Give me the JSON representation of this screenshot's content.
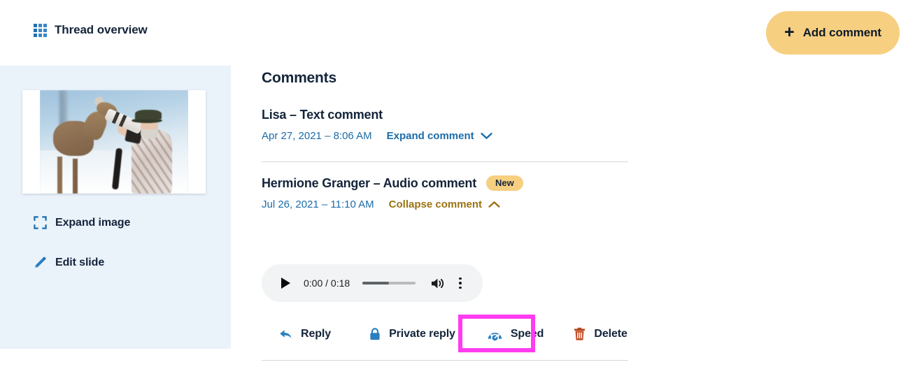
{
  "header": {
    "thread_overview_label": "Thread overview",
    "thread_overview_icon": "grid-icon",
    "add_comment_label": "Add comment",
    "add_comment_plus": "+",
    "add_comment_bg": "#f7cf80"
  },
  "sidebar": {
    "bg": "#eaf2fa",
    "thumbnail_alt": "Photographer in snow camouflage with telephoto lens being nuzzled by a deer",
    "actions": [
      {
        "label": "Expand image",
        "icon": "expand-icon"
      },
      {
        "label": "Edit slide",
        "icon": "pencil-icon"
      }
    ]
  },
  "main": {
    "title": "Comments",
    "comments": [
      {
        "title": "Lisa – Text comment",
        "date": "Apr 27, 2021 – 8:06 AM",
        "toggle_label": "Expand comment",
        "toggle_icon": "chevron-down-icon",
        "badge": null,
        "expanded": false
      },
      {
        "title": "Hermione Granger – Audio comment",
        "date": "Jul 26, 2021 – 11:10 AM",
        "toggle_label": "Collapse comment",
        "toggle_icon": "chevron-up-icon",
        "badge": "New",
        "expanded": true
      }
    ],
    "audio_player": {
      "time_display": "0:00 / 0:18",
      "current_time": "0:00",
      "duration": "0:18",
      "play_icon": "play-icon",
      "volume_icon": "volume-icon",
      "menu_icon": "three-dots-icon"
    },
    "actions": [
      {
        "label": "Reply",
        "icon": "reply-arrow-icon",
        "color": "#2a7fc0"
      },
      {
        "label": "Private reply",
        "icon": "lock-icon",
        "color": "#2a7fc0"
      },
      {
        "label": "Speed",
        "icon": "speedometer-icon",
        "color": "#2a7fc0"
      },
      {
        "label": "Delete",
        "icon": "trash-icon",
        "color": "#b5421c"
      }
    ]
  },
  "highlight": {
    "target": "Speed",
    "color": "#ff3cf0"
  }
}
